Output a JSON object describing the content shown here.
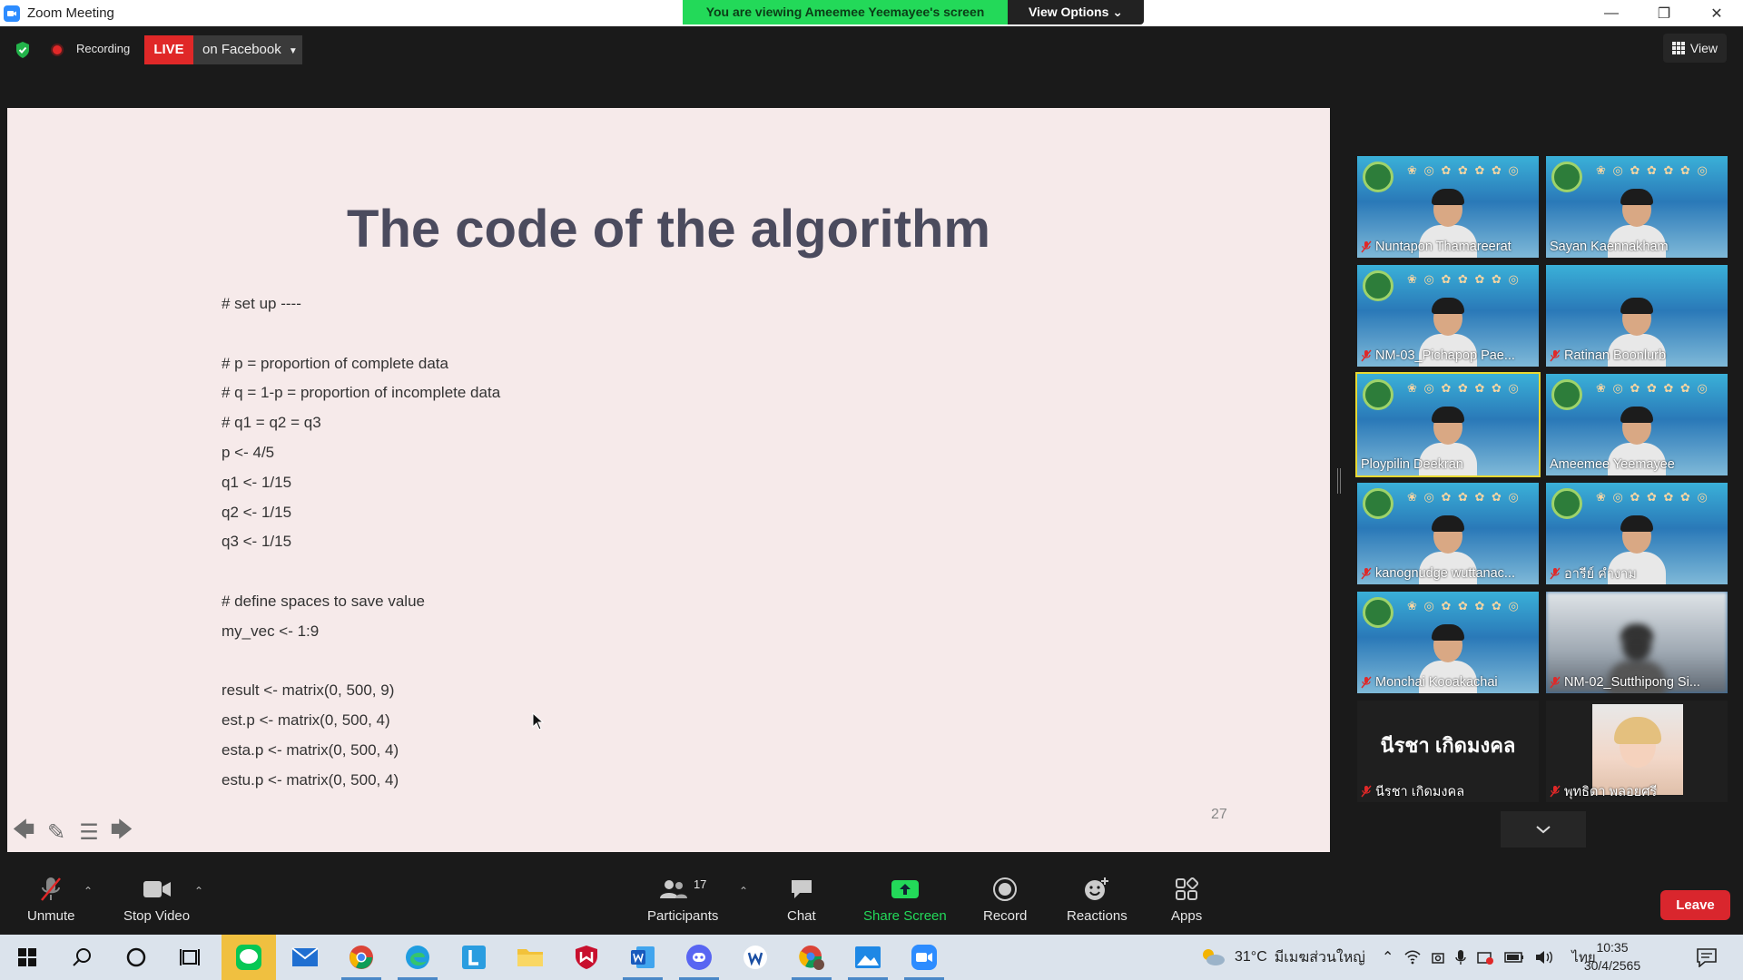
{
  "window": {
    "title": "Zoom Meeting",
    "viewing_banner": "You are viewing Ameemee Yeemayee's screen",
    "view_options": "View Options",
    "min": "—",
    "restore": "❐",
    "close": "✕"
  },
  "status": {
    "recording": "Recording",
    "live": "LIVE",
    "facebook": "on Facebook",
    "view": "View"
  },
  "slide": {
    "title": "The code of the algorithm",
    "code_lines": [
      "# set up ----",
      "",
      "# p = proportion of complete data",
      "# q = 1-p = proportion of incomplete data",
      "# q1 = q2 = q3",
      "p <- 4/5",
      "q1 <- 1/15",
      "q2 <- 1/15",
      "q3 <- 1/15",
      "",
      "# define spaces to save value",
      "my_vec <- 1:9",
      "",
      "result <- matrix(0, 500, 9)",
      "est.p <- matrix(0, 500, 4)",
      "esta.p <- matrix(0, 500, 4)",
      "estu.p <- matrix(0, 500, 4)"
    ],
    "page_number": "27"
  },
  "participants_gallery": [
    {
      "name": "Nuntapon Thamareerat",
      "muted": true
    },
    {
      "name": "Sayan Kaennakham",
      "muted": false
    },
    {
      "name": "NM-03_Pichapop Pae...",
      "muted": true
    },
    {
      "name": "Ratinan Boonlurb",
      "muted": true
    },
    {
      "name": "Ploypilin Deekran",
      "muted": false
    },
    {
      "name": "Ameemee Yeemayee",
      "muted": false
    },
    {
      "name": "kanognudge wuttanac...",
      "muted": true
    },
    {
      "name": "อารีย์ คำงาม",
      "muted": true
    },
    {
      "name": "Monchai Kooakachai",
      "muted": true
    },
    {
      "name": "NM-02_Sutthipong Si...",
      "muted": true
    },
    {
      "name": "นีรชา เกิดมงคล",
      "muted": true,
      "big_name": "นีรชา เกิดมงคล"
    },
    {
      "name": "พุทธิดา พลอยศรี",
      "muted": true
    }
  ],
  "controls": {
    "unmute": "Unmute",
    "stop_video": "Stop Video",
    "participants": "Participants",
    "participants_count": "17",
    "chat": "Chat",
    "share_screen": "Share Screen",
    "record": "Record",
    "reactions": "Reactions",
    "apps": "Apps",
    "leave": "Leave"
  },
  "taskbar": {
    "weather": "31°C",
    "weather_text": "มีเมฆส่วนใหญ่",
    "language": "ไทย",
    "time": "10:35",
    "date": "30/4/2565"
  },
  "colors": {
    "zoom_blue": "#2d8cff",
    "banner_green": "#23d959",
    "live_red": "#e02828",
    "leave_red": "#d9262d",
    "active_speaker": "#e8d832"
  }
}
